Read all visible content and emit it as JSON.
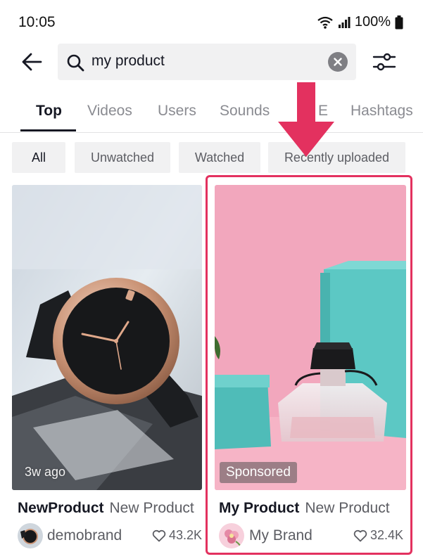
{
  "status_bar": {
    "time": "10:05",
    "battery": "100%"
  },
  "search": {
    "query": "my product"
  },
  "tabs": [
    {
      "label": "Top"
    },
    {
      "label": "Videos"
    },
    {
      "label": "Users"
    },
    {
      "label": "Sounds"
    },
    {
      "label": "E"
    },
    {
      "label": "Hashtags"
    }
  ],
  "filters": [
    {
      "label": "All"
    },
    {
      "label": "Unwatched"
    },
    {
      "label": "Watched"
    },
    {
      "label": "Recently uploaded"
    }
  ],
  "results": [
    {
      "title": "NewProduct",
      "subtitle": "New Product",
      "author": "demobrand",
      "likes": "43.2K",
      "overlay": "3w ago"
    },
    {
      "title": "My Product",
      "subtitle": "New Product",
      "author": "My Brand",
      "likes": "32.4K",
      "overlay": "Sponsored"
    }
  ],
  "colors": {
    "highlight": "#e3315f",
    "card2_background": "#f2a7bd",
    "box": "#5cc8c4"
  }
}
